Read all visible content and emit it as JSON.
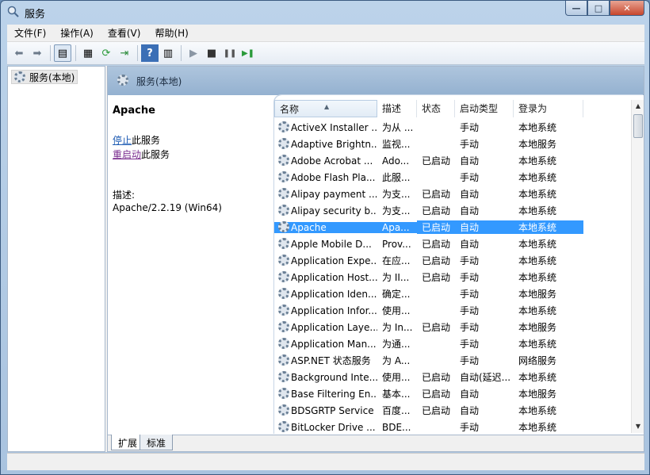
{
  "window": {
    "title": "服务",
    "min_symbol": "—",
    "max_symbol": "□",
    "close_symbol": "✕"
  },
  "menu": [
    "文件(F)",
    "操作(A)",
    "查看(V)",
    "帮助(H)"
  ],
  "toolbar": {
    "back_icon": "⬅",
    "forward_icon": "➡",
    "btn3": "▤",
    "btn4": "▦",
    "btn5": "⟳",
    "btn6": "⇥",
    "btn7": "?",
    "btn8": "▥",
    "play": "▶",
    "stop": "■",
    "pause": "❚❚",
    "resume": "▶❚"
  },
  "tree": {
    "root_label": "服务(本地)"
  },
  "content": {
    "title": "服务(本地)"
  },
  "detail": {
    "service_name": "Apache",
    "stop_link": "停止",
    "stop_suffix": "此服务",
    "restart_link": "重启动",
    "restart_suffix": "此服务",
    "desc_label": "描述:",
    "desc_text": "Apache/2.2.19 (Win64)"
  },
  "columns": [
    "名称",
    "描述",
    "状态",
    "启动类型",
    "登录为"
  ],
  "sort_indicator": "▲",
  "rows": [
    {
      "name": "ActiveX Installer ...",
      "desc": "为从 ...",
      "status": "",
      "start": "手动",
      "logon": "本地系统"
    },
    {
      "name": "Adaptive Brightn...",
      "desc": "监视...",
      "status": "",
      "start": "手动",
      "logon": "本地服务"
    },
    {
      "name": "Adobe Acrobat ...",
      "desc": "Ado...",
      "status": "已启动",
      "start": "自动",
      "logon": "本地系统"
    },
    {
      "name": "Adobe Flash Pla...",
      "desc": "此服...",
      "status": "",
      "start": "手动",
      "logon": "本地系统"
    },
    {
      "name": "Alipay payment ...",
      "desc": "为支...",
      "status": "已启动",
      "start": "自动",
      "logon": "本地系统"
    },
    {
      "name": "Alipay security b...",
      "desc": "为支...",
      "status": "已启动",
      "start": "自动",
      "logon": "本地系统"
    },
    {
      "name": "Apache",
      "desc": "Apa...",
      "status": "已启动",
      "start": "自动",
      "logon": "本地系统"
    },
    {
      "name": "Apple Mobile D...",
      "desc": "Prov...",
      "status": "已启动",
      "start": "自动",
      "logon": "本地系统"
    },
    {
      "name": "Application Expe...",
      "desc": "在应...",
      "status": "已启动",
      "start": "手动",
      "logon": "本地系统"
    },
    {
      "name": "Application Host...",
      "desc": "为 II...",
      "status": "已启动",
      "start": "手动",
      "logon": "本地系统"
    },
    {
      "name": "Application Iden...",
      "desc": "确定...",
      "status": "",
      "start": "手动",
      "logon": "本地服务"
    },
    {
      "name": "Application Infor...",
      "desc": "使用...",
      "status": "",
      "start": "手动",
      "logon": "本地系统"
    },
    {
      "name": "Application Laye...",
      "desc": "为 In...",
      "status": "已启动",
      "start": "手动",
      "logon": "本地服务"
    },
    {
      "name": "Application Man...",
      "desc": "为通...",
      "status": "",
      "start": "手动",
      "logon": "本地系统"
    },
    {
      "name": "ASP.NET 状态服务",
      "desc": "为 A...",
      "status": "",
      "start": "手动",
      "logon": "网络服务"
    },
    {
      "name": "Background Inte...",
      "desc": "使用...",
      "status": "已启动",
      "start": "自动(延迟...",
      "logon": "本地系统"
    },
    {
      "name": "Base Filtering En...",
      "desc": "基本...",
      "status": "已启动",
      "start": "自动",
      "logon": "本地服务"
    },
    {
      "name": "BDSGRTP Service",
      "desc": "百度...",
      "status": "已启动",
      "start": "自动",
      "logon": "本地系统"
    },
    {
      "name": "BitLocker Drive ...",
      "desc": "BDE...",
      "status": "",
      "start": "手动",
      "logon": "本地系统"
    }
  ],
  "selected_row_index": 6,
  "scroll": {
    "up": "▲",
    "down": "▼"
  },
  "tabs": [
    "扩展",
    "标准"
  ]
}
